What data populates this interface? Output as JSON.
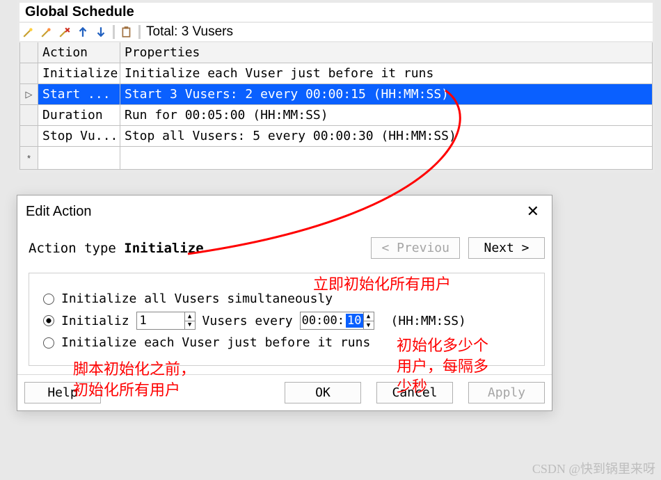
{
  "panel": {
    "title": "Global Schedule",
    "total": "Total: 3 Vusers"
  },
  "grid": {
    "headers": {
      "action": "Action",
      "properties": "Properties"
    },
    "rows": [
      {
        "marker": "",
        "action": "Initialize",
        "properties": "Initialize each Vuser just before it runs"
      },
      {
        "marker": "▷",
        "action": "Start  ...",
        "properties": "Start 3 Vusers: 2 every 00:00:15 (HH:MM:SS)",
        "selected": true
      },
      {
        "marker": "",
        "action": "Duration",
        "properties": "Run for 00:05:00 (HH:MM:SS)"
      },
      {
        "marker": "",
        "action": "Stop Vu...",
        "properties": "Stop all Vusers: 5 every 00:00:30 (HH:MM:SS)"
      }
    ],
    "blankMarker": "*"
  },
  "dialog": {
    "title": "Edit Action",
    "actionTypeLabel": "Action type ",
    "actionTypeValue": "Initialize",
    "prev": "<  Previou",
    "next": "Next  >",
    "opt1": "Initialize all Vusers simultaneously",
    "opt2a": "Initializ",
    "opt2_count": "1",
    "opt2_mid": "Vusers every",
    "opt2_time_a": "00:00:",
    "opt2_time_sel": "10",
    "opt2_hms": "(HH:MM:SS)",
    "opt3": "Initialize each Vuser just before it runs",
    "help": "Help",
    "ok": "OK",
    "cancel": "Cancel",
    "apply": "Apply"
  },
  "annotations": {
    "a1": "立即初始化所有用户",
    "a2": "脚本初始化之前，\n初始化所有用户",
    "a3": "初始化多少个\n用户，每隔多\n少秒"
  },
  "watermark": "CSDN @快到锅里来呀"
}
